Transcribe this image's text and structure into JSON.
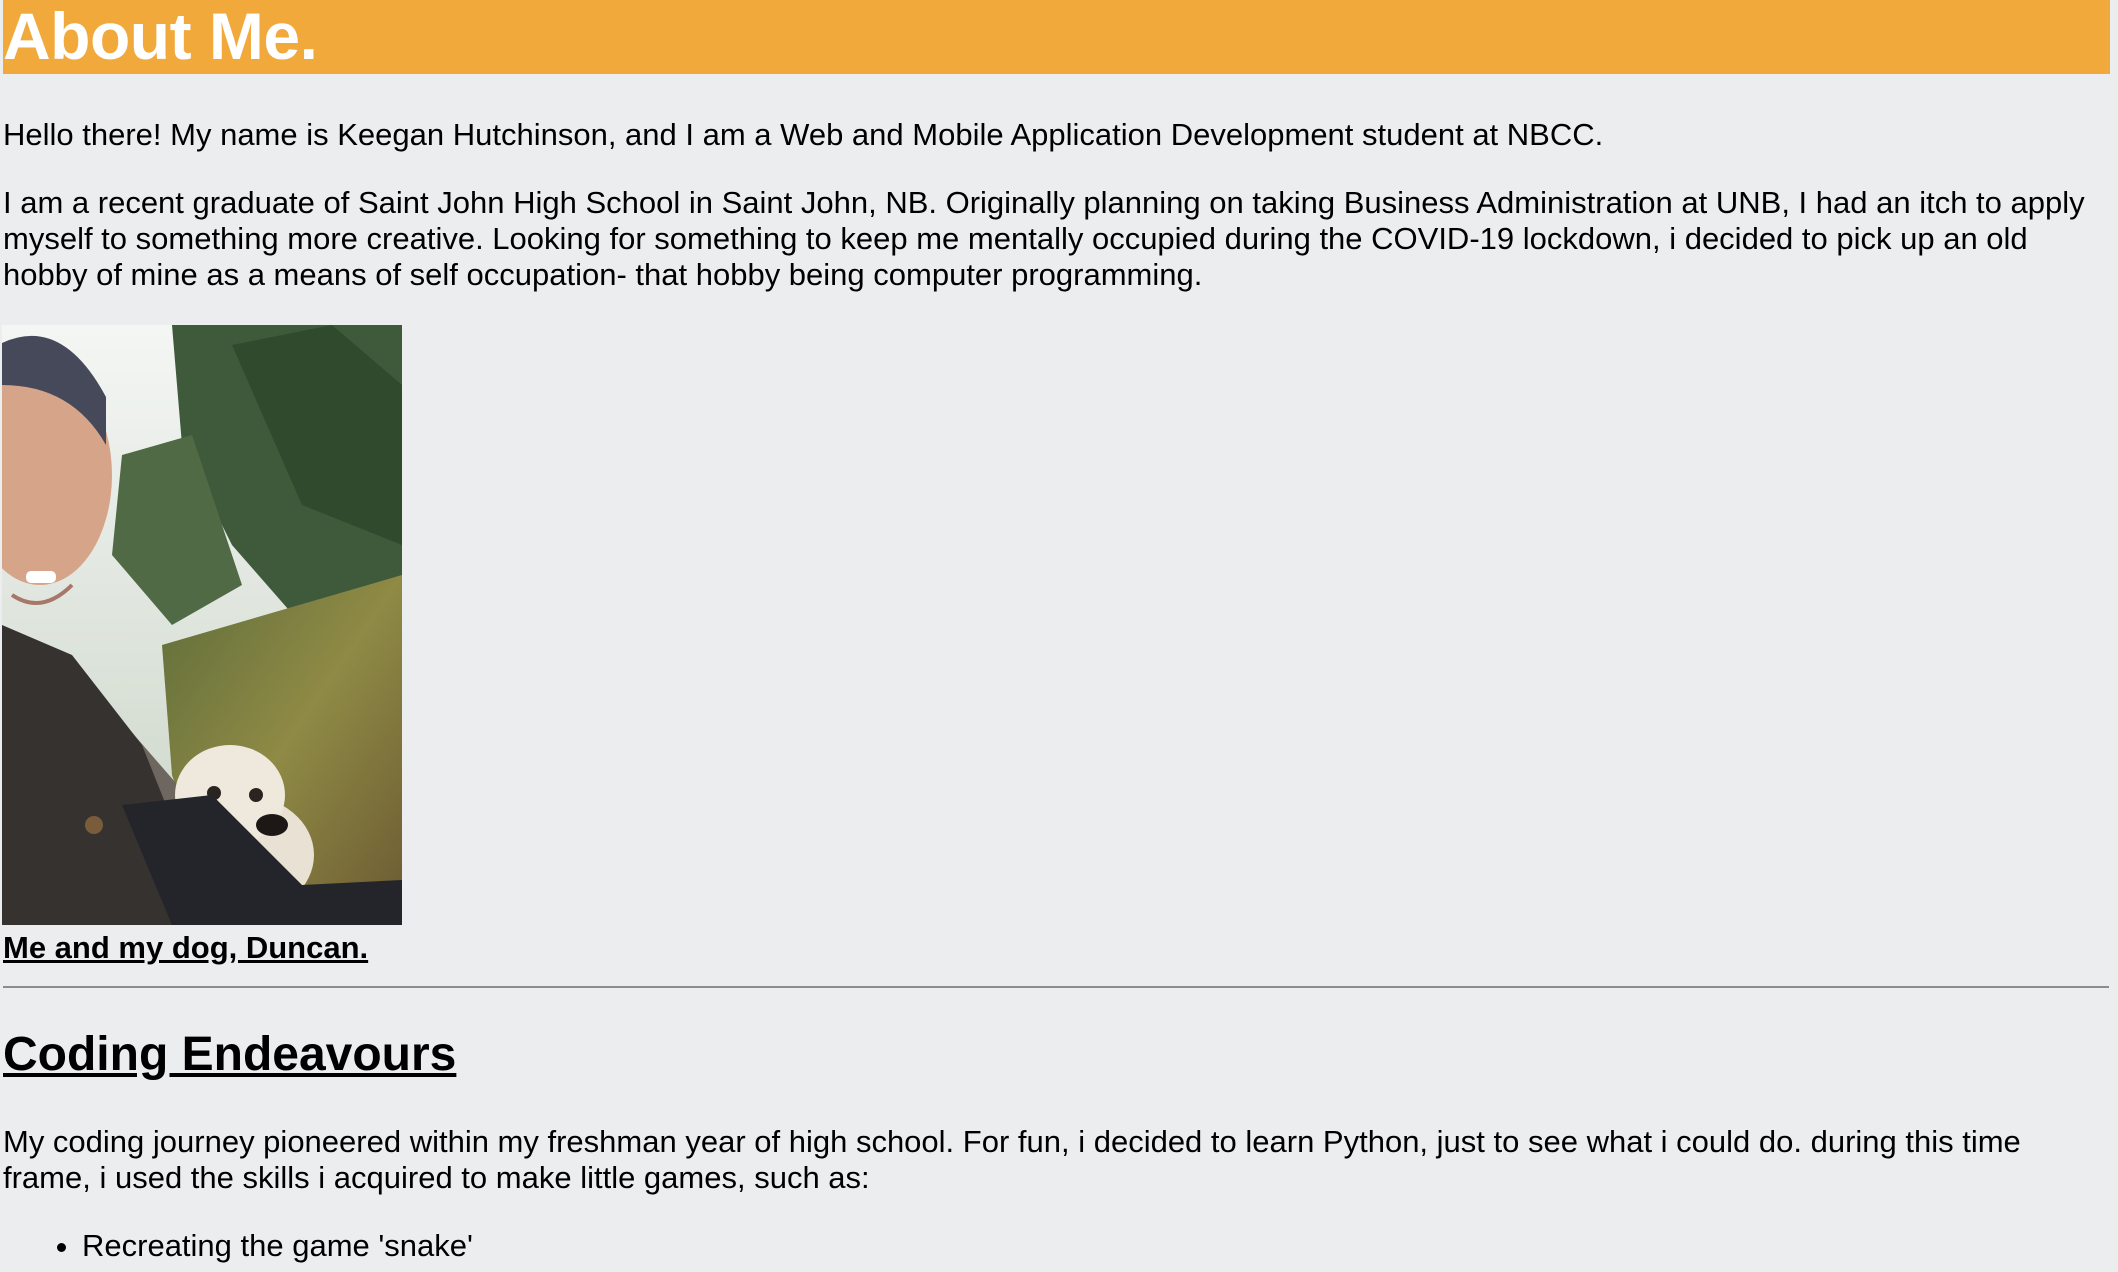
{
  "header": {
    "title": "About Me.",
    "background_color": "#f2a93b",
    "text_color": "#ffffff"
  },
  "page": {
    "background_color": "#ecedef"
  },
  "about": {
    "intro": "Hello there! My name is Keegan Hutchinson, and I am a Web and Mobile Application Development student at NBCC.",
    "bio": "I am a recent graduate of Saint John High School in Saint John, NB. Originally planning on taking Business Administration at UNB, I had an itch to apply myself to something more creative. Looking for something to keep me mentally occupied during the COVID-19 lockdown, i decided to pick up an old hobby of mine as a means of self occupation- that hobby being computer programming."
  },
  "photo": {
    "caption": "Me and my dog, Duncan."
  },
  "coding": {
    "heading": "Coding Endeavours",
    "intro": "My coding journey pioneered within my freshman year of high school. For fun, i decided to learn Python, just to see what i could do. during this time frame, i used the skills i acquired to make little games, such as:",
    "games": [
      "Recreating the game 'snake'"
    ]
  }
}
